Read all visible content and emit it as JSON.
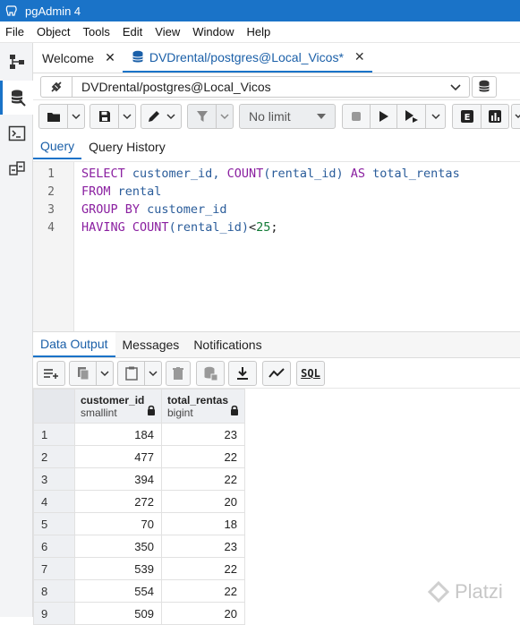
{
  "app": {
    "title": "pgAdmin 4"
  },
  "menu": [
    "File",
    "Object",
    "Tools",
    "Edit",
    "View",
    "Window",
    "Help"
  ],
  "tabs": [
    {
      "label": "Welcome"
    },
    {
      "label": "DVDrental/postgres@Local_Vicos*"
    }
  ],
  "connection": {
    "label": "DVDrental/postgres@Local_Vicos"
  },
  "toolbar": {
    "limit_label": "No limit"
  },
  "query_tabs": [
    "Query",
    "Query History"
  ],
  "editor": {
    "lines": [
      {
        "n": "1",
        "tokens": [
          {
            "t": "SELECT",
            "k": "kw"
          },
          {
            "t": " customer_id, ",
            "k": "id"
          },
          {
            "t": "COUNT",
            "k": "kw"
          },
          {
            "t": "(rental_id) ",
            "k": "id"
          },
          {
            "t": "AS",
            "k": "kw"
          },
          {
            "t": " total_rentas",
            "k": "id"
          }
        ]
      },
      {
        "n": "2",
        "tokens": [
          {
            "t": "FROM",
            "k": "kw"
          },
          {
            "t": " rental",
            "k": "id"
          }
        ]
      },
      {
        "n": "3",
        "tokens": [
          {
            "t": "GROUP BY",
            "k": "kw"
          },
          {
            "t": " customer_id",
            "k": "id"
          }
        ]
      },
      {
        "n": "4",
        "tokens": [
          {
            "t": "HAVING",
            "k": "kw"
          },
          {
            "t": " ",
            "k": "plain"
          },
          {
            "t": "COUNT",
            "k": "kw"
          },
          {
            "t": "(rental_id)",
            "k": "id"
          },
          {
            "t": "<",
            "k": "plain"
          },
          {
            "t": "25",
            "k": "num"
          },
          {
            "t": ";",
            "k": "plain"
          }
        ]
      }
    ]
  },
  "output_tabs": [
    "Data Output",
    "Messages",
    "Notifications"
  ],
  "output_toolbar": {
    "sql_label": "SQL"
  },
  "grid": {
    "columns": [
      {
        "name": "customer_id",
        "type": "smallint"
      },
      {
        "name": "total_rentas",
        "type": "bigint"
      }
    ],
    "rows": [
      [
        "1",
        "184",
        "23"
      ],
      [
        "2",
        "477",
        "22"
      ],
      [
        "3",
        "394",
        "22"
      ],
      [
        "4",
        "272",
        "20"
      ],
      [
        "5",
        "70",
        "18"
      ],
      [
        "6",
        "350",
        "23"
      ],
      [
        "7",
        "539",
        "22"
      ],
      [
        "8",
        "554",
        "22"
      ],
      [
        "9",
        "509",
        "20"
      ]
    ]
  },
  "watermark": {
    "label": "Platzi"
  },
  "colors": {
    "accent": "#1a73c8",
    "keyword": "#8a1fa0",
    "identifier": "#2a5c9a",
    "number": "#117a35"
  }
}
